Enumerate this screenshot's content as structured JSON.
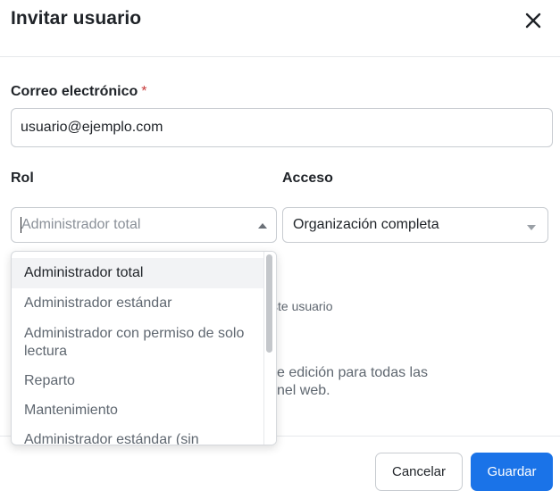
{
  "dialog": {
    "title": "Invitar usuario",
    "close_icon": "close-icon"
  },
  "email": {
    "label": "Correo electrónico",
    "required_mark": "*",
    "value": "usuario@ejemplo.com"
  },
  "role": {
    "label": "Rol",
    "placeholder": "Administrador total",
    "caret_icon": "caret-up-icon",
    "options": [
      "Administrador total",
      "Administrador estándar",
      "Administrador con permiso de solo lectura",
      "Reparto",
      "Mantenimiento",
      "Administrador estándar (sin"
    ],
    "selected_index": 0
  },
  "access": {
    "label": "Acceso",
    "value": "Organización completa",
    "caret_icon": "caret-down-icon"
  },
  "background_text": {
    "hint_fragment": "ste usuario",
    "desc_line1": "e edición para todas las",
    "desc_line2": "nel web."
  },
  "footer": {
    "cancel_label": "Cancelar",
    "save_label": "Guardar"
  },
  "colors": {
    "primary": "#1a73e8",
    "required": "#c73a3a",
    "border": "#c8ccd1"
  }
}
